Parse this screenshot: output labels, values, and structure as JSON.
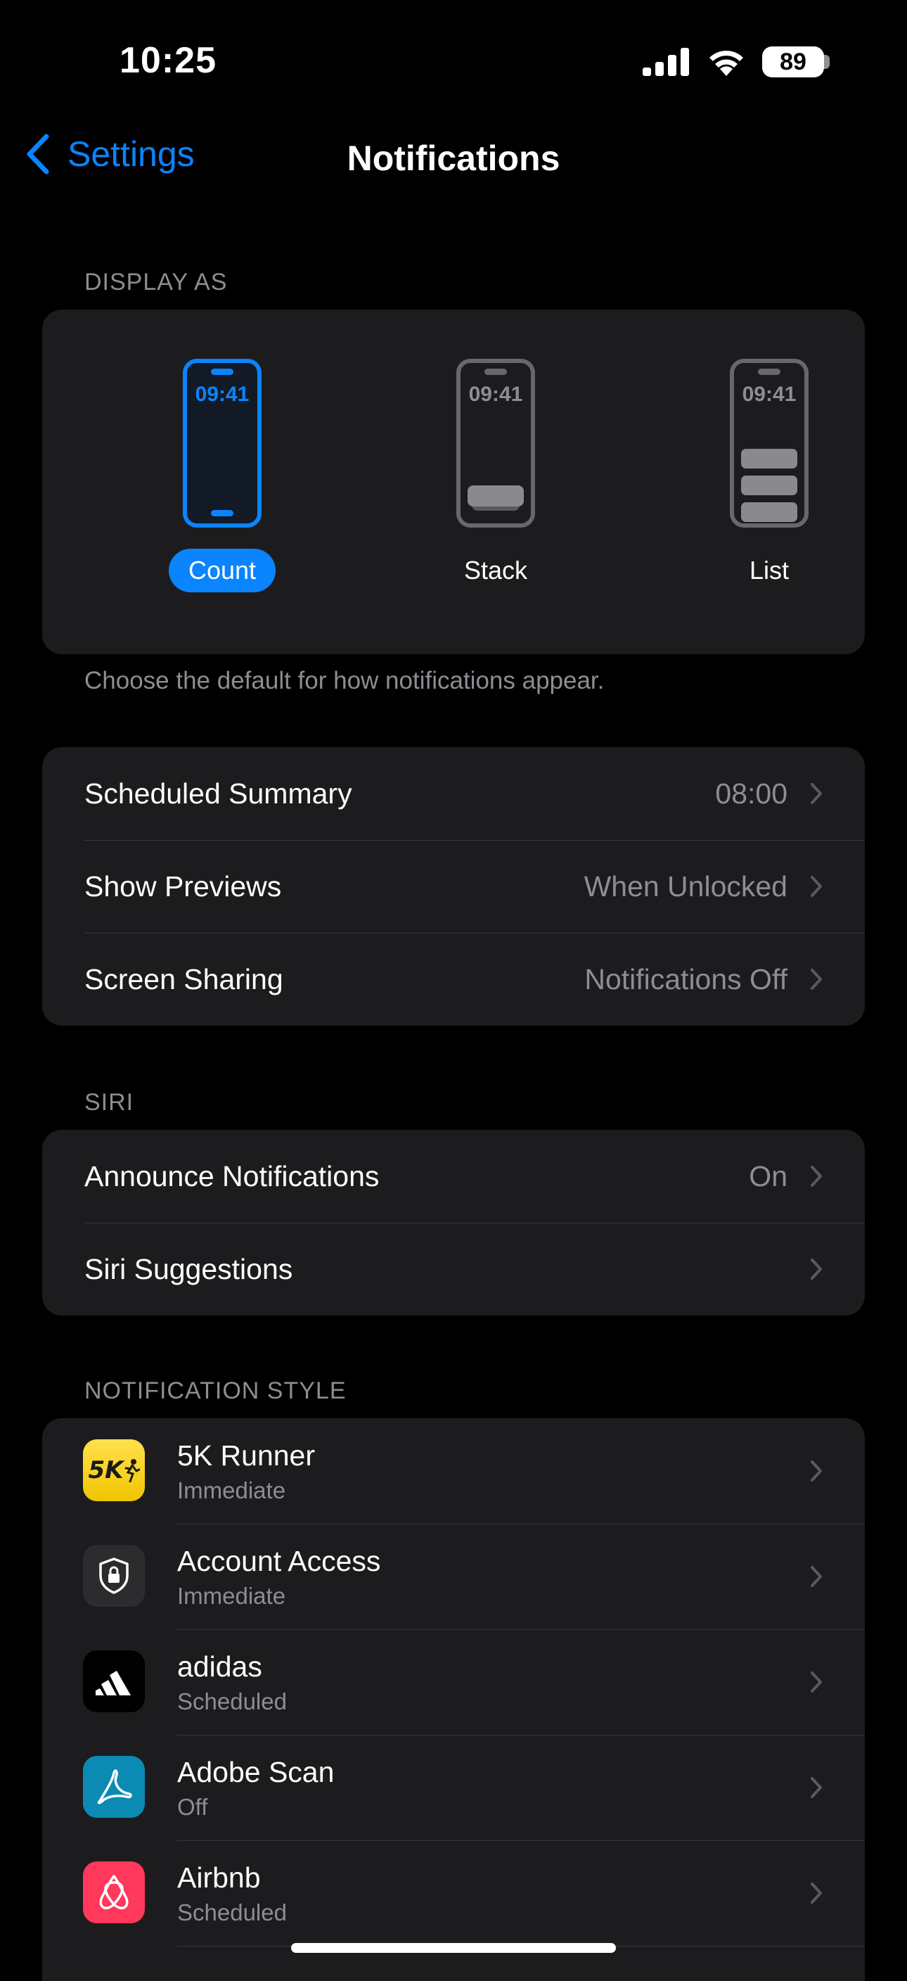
{
  "status_bar": {
    "time": "10:25",
    "battery": "89"
  },
  "nav": {
    "back_label": "Settings",
    "title": "Notifications"
  },
  "display_as": {
    "header": "DISPLAY AS",
    "options": [
      {
        "label": "Count",
        "clock": "09:41",
        "selected": true
      },
      {
        "label": "Stack",
        "clock": "09:41",
        "selected": false
      },
      {
        "label": "List",
        "clock": "09:41",
        "selected": false
      }
    ],
    "footer": "Choose the default for how notifications appear."
  },
  "settings": [
    {
      "label": "Scheduled Summary",
      "value": "08:00"
    },
    {
      "label": "Show Previews",
      "value": "When Unlocked"
    },
    {
      "label": "Screen Sharing",
      "value": "Notifications Off"
    }
  ],
  "siri": {
    "header": "SIRI",
    "rows": [
      {
        "label": "Announce Notifications",
        "value": "On"
      },
      {
        "label": "Siri Suggestions",
        "value": ""
      }
    ]
  },
  "notification_style": {
    "header": "NOTIFICATION STYLE",
    "apps": [
      {
        "name": "5K Runner",
        "status": "Immediate",
        "icon": "5k-runner-icon",
        "icon_text": "5K"
      },
      {
        "name": "Account Access",
        "status": "Immediate",
        "icon": "account-access-icon"
      },
      {
        "name": "adidas",
        "status": "Scheduled",
        "icon": "adidas-icon"
      },
      {
        "name": "Adobe Scan",
        "status": "Off",
        "icon": "adobe-scan-icon"
      },
      {
        "name": "Airbnb",
        "status": "Scheduled",
        "icon": "airbnb-icon"
      }
    ]
  },
  "colors": {
    "accent": "#0a84ff",
    "group_bg": "#1c1c1e",
    "secondary_text": "#8d8d93"
  }
}
